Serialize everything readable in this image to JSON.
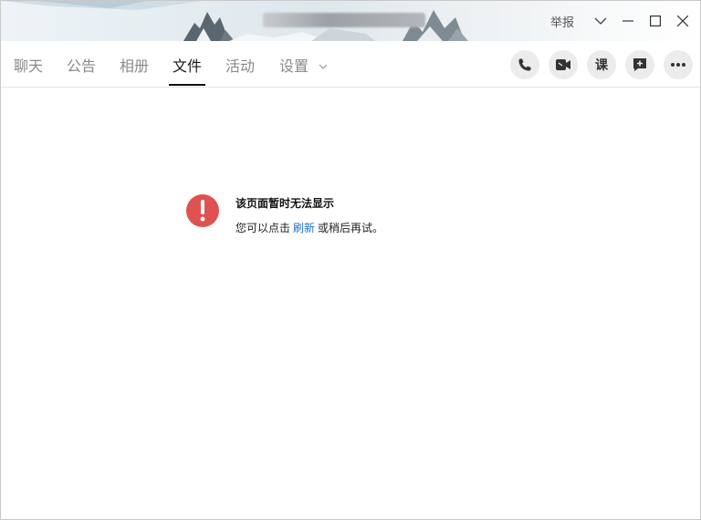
{
  "window": {
    "report_label": "举报"
  },
  "tabs": [
    {
      "label": "聊天",
      "active": false
    },
    {
      "label": "公告",
      "active": false
    },
    {
      "label": "相册",
      "active": false
    },
    {
      "label": "文件",
      "active": true
    },
    {
      "label": "活动",
      "active": false
    },
    {
      "label": "设置",
      "active": false
    }
  ],
  "actions": {
    "course_glyph": "课"
  },
  "error": {
    "title": "该页面暂时无法显示",
    "message_before": "您可以点击",
    "refresh_link": "刷新",
    "message_after": "或稍后再试。"
  },
  "colors": {
    "error_icon": "#e05252",
    "link": "#1a73c8",
    "active_tab": "#1a1a1a",
    "inactive_tab": "#8a8a8a"
  }
}
